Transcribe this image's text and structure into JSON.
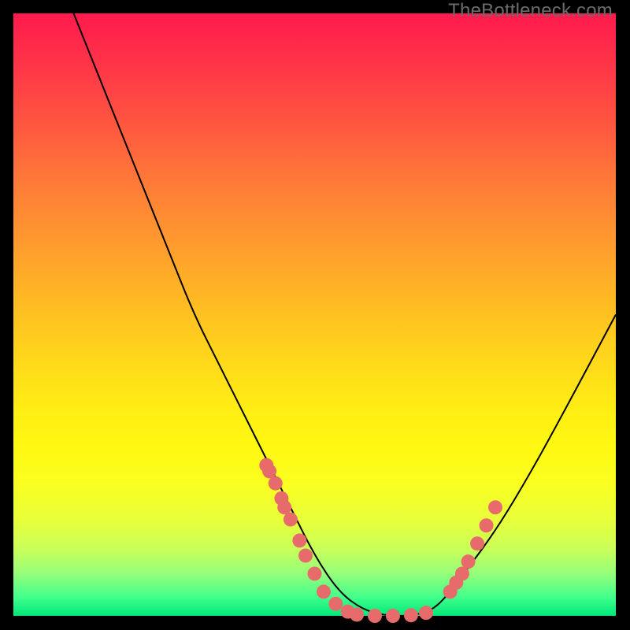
{
  "watermark": "TheBottleneck.com",
  "chart_data": {
    "type": "line",
    "title": "",
    "xlabel": "",
    "ylabel": "",
    "xlim": [
      0,
      100
    ],
    "ylim": [
      0,
      100
    ],
    "grid": false,
    "series": [
      {
        "name": "curve",
        "x": [
          10,
          14,
          18,
          22,
          26,
          30,
          34,
          38,
          42,
          46,
          50,
          54,
          58,
          62,
          66,
          70,
          74,
          80,
          86,
          92,
          100
        ],
        "y": [
          100,
          90,
          80,
          70,
          60,
          50,
          42,
          34,
          26,
          18,
          10,
          4,
          1,
          0,
          0,
          1,
          6,
          14,
          24,
          35,
          50
        ],
        "stroke": "#000000",
        "stroke_width": 2
      },
      {
        "name": "marker-band-left",
        "type": "scatter",
        "x": [
          42,
          42.5,
          43.5,
          44.5,
          45,
          46,
          47.5,
          48.5,
          50,
          51.5,
          53.5,
          55.5
        ],
        "y": [
          25,
          24,
          22,
          19.5,
          18,
          16,
          12.5,
          10,
          7,
          4,
          2,
          0.7
        ],
        "color": "#e86b6b",
        "marker_radius": 9
      },
      {
        "name": "marker-band-bottom",
        "type": "scatter",
        "x": [
          57,
          60,
          63,
          66,
          68.5
        ],
        "y": [
          0.2,
          0,
          0,
          0.1,
          0.5
        ],
        "color": "#e86b6b",
        "marker_radius": 9
      },
      {
        "name": "marker-band-right",
        "type": "scatter",
        "x": [
          72.5,
          73.5,
          74.5,
          75.5,
          77,
          78.5,
          80
        ],
        "y": [
          4,
          5.5,
          7,
          9,
          12,
          15,
          18
        ],
        "color": "#e86b6b",
        "marker_radius": 9
      }
    ]
  }
}
